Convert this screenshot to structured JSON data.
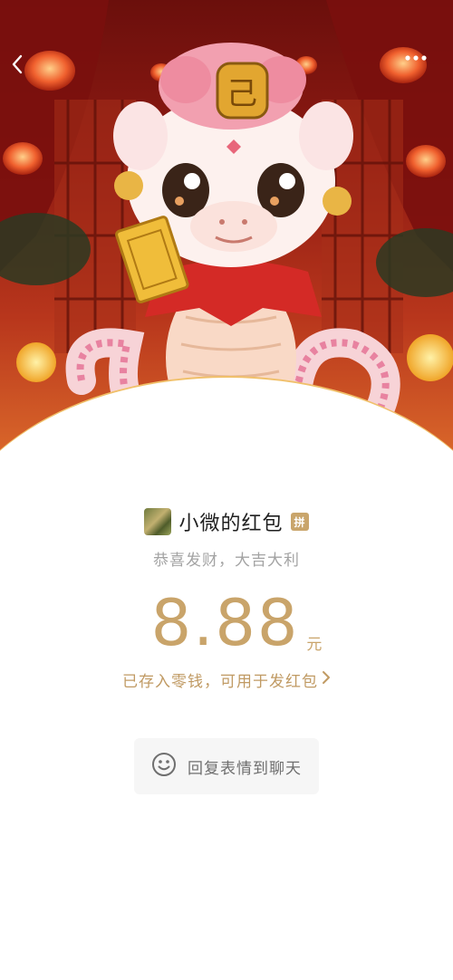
{
  "nav": {
    "back_icon": "chevron-left-icon",
    "more_icon": "more-dots-icon"
  },
  "envelope": {
    "sender_name": "小微的红包",
    "sender_badge": "拼",
    "greeting": "恭喜发财，大吉大利",
    "amount": "8.88",
    "unit": "元",
    "change_note": "已存入零钱，可用于发红包",
    "change_chevron_icon": "chevron-right-icon"
  },
  "reply": {
    "icon": "smiley-icon",
    "label": "回复表情到聊天"
  },
  "colors": {
    "accent_gold": "#c9a46a",
    "hero_red": "#8e1a12",
    "text_gray": "#a3a3a3"
  }
}
